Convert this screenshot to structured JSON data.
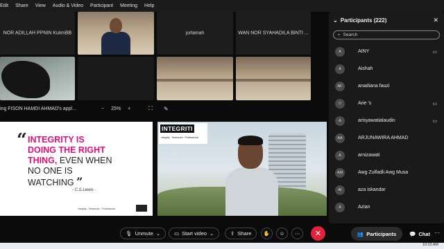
{
  "menu": [
    "Edit",
    "Share",
    "View",
    "Audio & Video",
    "Participant",
    "Meeting",
    "Help"
  ],
  "tiles": {
    "t1_name": "NOR ADILLAH PPNIN KulimBB",
    "t3_name": "jurlainah",
    "t4_name": "WAN NOR SYAHADILA BINTI ..."
  },
  "share_bar": {
    "viewing": "ing FISON HAMDI AHMAD's appl...",
    "zoom_out": "−",
    "zoom_level": "25%",
    "zoom_in": "+"
  },
  "slide": {
    "open_quote": "“",
    "line_pink_1": "INTEGRITY IS",
    "line_pink_2": "DOING THE RIGHT",
    "line_pink_3": "THING,",
    "line_dark_1": " EVEN WHEN",
    "line_dark_2": "NO ONE IS",
    "line_dark_3": "WATCHING",
    "close_quote": "”",
    "author": "- C.S.Lewis -",
    "footer": "Integrity · Teamwork · Professional"
  },
  "speaker_overlay": {
    "title": "INTEGRITI",
    "subtitle": "Integrity · Teamwork · Professional"
  },
  "panel": {
    "title": "Participants (222)",
    "search_placeholder": "Search",
    "participants": [
      {
        "initials": "A",
        "name": "AINY",
        "cam": true
      },
      {
        "initials": "A",
        "name": "Aishah",
        "cam": false
      },
      {
        "initials": "AF",
        "name": "anadiana fauzi",
        "cam": false
      },
      {
        "initials": "",
        "name": "Arie 's",
        "cam": true
      },
      {
        "initials": "A",
        "name": "arisyawatialaudin",
        "cam": true
      },
      {
        "initials": "AA",
        "name": "ARJUNAWIRA AHMAD",
        "cam": false
      },
      {
        "initials": "A",
        "name": "arnizawati",
        "cam": false
      },
      {
        "initials": "AM",
        "name": "Awg Zulfadli Awg Musa",
        "cam": false
      },
      {
        "initials": "AI",
        "name": "aza iskandar",
        "cam": false
      },
      {
        "initials": "A",
        "name": "Azian",
        "cam": false
      }
    ]
  },
  "controls": {
    "unmute": "Unmute",
    "start_video": "Start video",
    "share": "Share",
    "participants": "Participants",
    "chat": "Chat"
  },
  "taskbar": {
    "time": "10:33 AM"
  },
  "colors": {
    "accent_pink": "#e0107a",
    "end_call": "#e0233b"
  }
}
